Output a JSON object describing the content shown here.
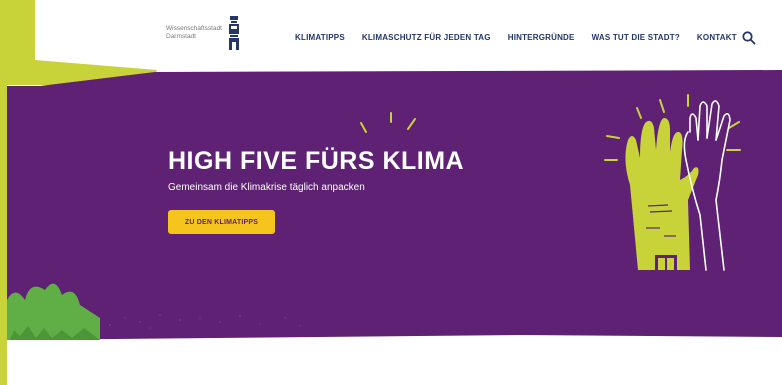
{
  "logo": {
    "line1": "Wissenschaftsstadt",
    "line2": "Darmstadt",
    "icon": "city-crest-icon"
  },
  "nav": {
    "items": [
      {
        "label": "KLIMATIPPS"
      },
      {
        "label": "KLIMASCHUTZ FÜR JEDEN TAG"
      },
      {
        "label": "HINTERGRÜNDE"
      },
      {
        "label": "WAS TUT DIE STADT?"
      },
      {
        "label": "KONTAKT"
      }
    ],
    "search_icon": "search-icon"
  },
  "hero": {
    "title": "HIGH FIVE FÜRS KLIMA",
    "subtitle": "Gemeinsam die Klimakrise täglich anpacken",
    "cta_label": "ZU DEN KLIMATIPPS",
    "illustration": "high-five-hands-illustration"
  },
  "colors": {
    "purple": "#5e2173",
    "lime": "#c8d33a",
    "yellow": "#f6c51d",
    "navy": "#24376b",
    "green": "#5fae46"
  }
}
